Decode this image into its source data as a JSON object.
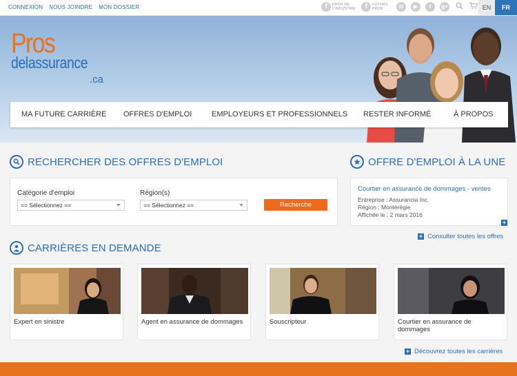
{
  "top_links": [
    "CONNEXION",
    "NOUS JOINDRE",
    "MON DOSSIER"
  ],
  "social": {
    "industry_label": "PROS DE L'INDUSTRIE",
    "future_label": "FUTURS PROS"
  },
  "lang": {
    "en": "EN",
    "fr": "FR"
  },
  "logo": {
    "pros": "Pros",
    "de": "delassurance",
    "ca": ".ca"
  },
  "nav": [
    "MA FUTURE CARRIÈRE",
    "OFFRES D'EMPLOI",
    "EMPLOYEURS ET PROFESSIONNELS",
    "RESTER INFORMÉ",
    "À PROPOS"
  ],
  "search": {
    "title": "RECHERCHER DES OFFRES D'EMPLOI",
    "category_label": "Catégorie d'emploi",
    "category_value": "== Sélectionnez ==",
    "region_label": "Région(s)",
    "region_value": "== Sélectionnez ==",
    "button": "Recherche"
  },
  "featured": {
    "title": "OFFRE D'EMPLOI À LA UNE",
    "job_title": "Courtier en assurance de dommages - ventes",
    "company": "Entreprise : Assurancia Inc.",
    "region": "Région : Montérégie",
    "posted": "Affichée le : 2 mars 2016",
    "all_link": "Consulter toutes les offres"
  },
  "careers": {
    "title": "CARRIÈRES EN DEMANDE",
    "cards": [
      {
        "label": "Expert en sinistre"
      },
      {
        "label": "Agent en assurance de dommages"
      },
      {
        "label": "Souscripteur"
      },
      {
        "label": "Courtier en assurance de dommages"
      }
    ],
    "all_link": "Découvrez toutes les carrières"
  },
  "colors": {
    "brand_blue": "#2c6eb5",
    "brand_orange": "#e8731f"
  }
}
